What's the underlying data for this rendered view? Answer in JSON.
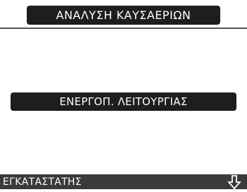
{
  "header": {
    "title": "ΑΝΑΛΥΣΗ ΚΑΥΣΑΕΡΙΩΝ"
  },
  "menu": {
    "items": [
      {
        "label": "ΕΝΕΡΓΟΠ. ΛΕΙΤΟΥΡΓΙΑΣ"
      }
    ]
  },
  "footer": {
    "left_label": "ΕΓΚΑΤΑΣΤΑΤΗΣ",
    "right_icon": "arrow-down-icon"
  },
  "colors": {
    "bar_dark": "#1e1e1e",
    "footer_bg": "#3a3a3a",
    "text_light": "#ffffff"
  }
}
